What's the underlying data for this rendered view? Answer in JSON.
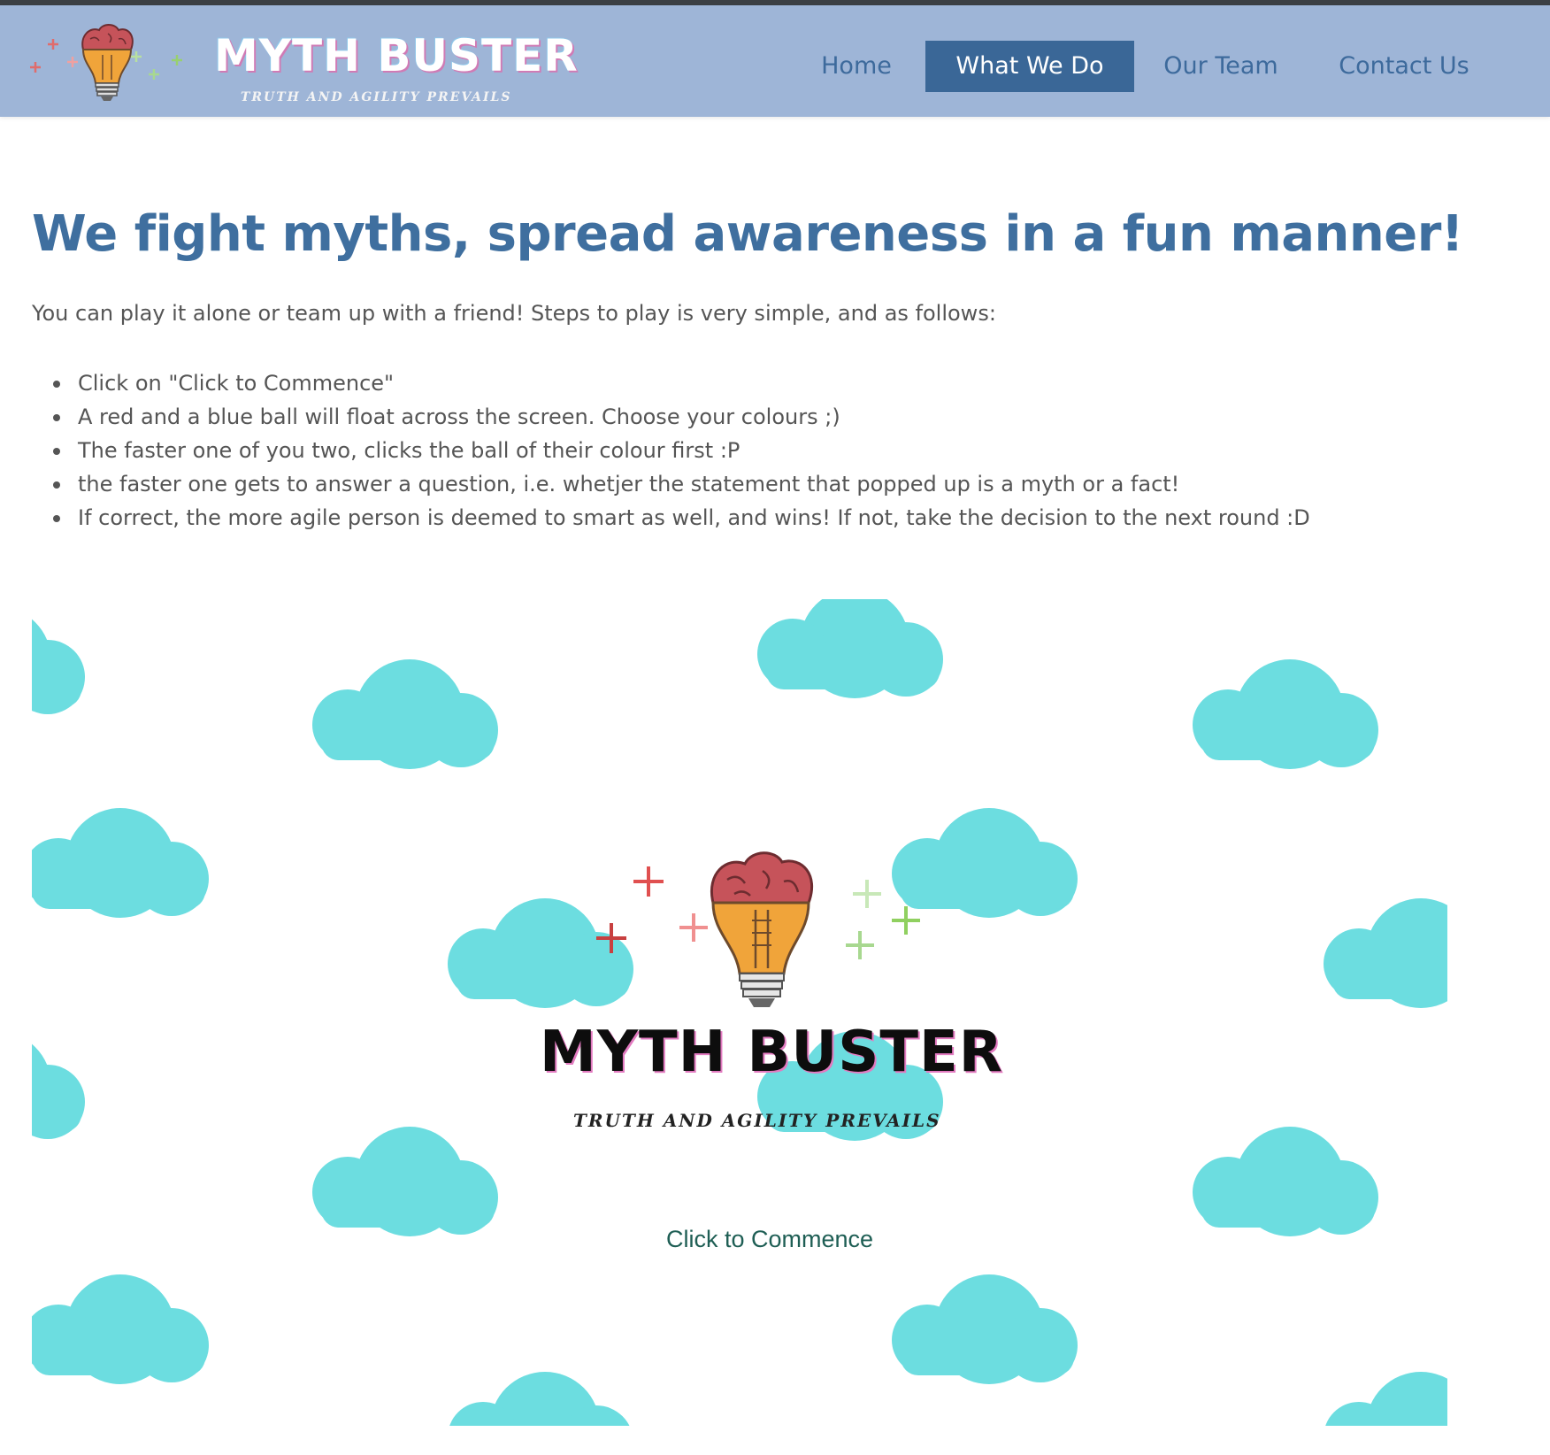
{
  "brand": {
    "title": "MYTH BUSTER",
    "tagline": "TRUTH AND AGILITY PREVAILS",
    "logo_icon": "brain-lightbulb-icon"
  },
  "nav": {
    "items": [
      {
        "label": "Home",
        "active": false
      },
      {
        "label": "What We Do",
        "active": true
      },
      {
        "label": "Our Team",
        "active": false
      },
      {
        "label": "Contact Us",
        "active": false
      }
    ]
  },
  "main": {
    "headline": "We fight myths, spread awareness in a fun manner!",
    "intro": "You can play it alone or team up with a friend! Steps to play is very simple, and as follows:",
    "steps": [
      "Click on \"Click to Commence\"",
      "A red and a blue ball will float across the screen. Choose your colours ;)",
      "The faster one of you two, clicks the ball of their colour first :P",
      "the faster one gets to answer a question, i.e. whetjer the statement that popped up is a myth or a fact!",
      "If correct, the more agile person is deemed to smart as well, and wins! If not, take the decision to the next round :D"
    ]
  },
  "game": {
    "title": "MYTH BUSTER",
    "tagline": "TRUTH AND AGILITY PREVAILS",
    "start_label": "Click to Commence",
    "background_icon": "cloud-icon"
  },
  "colors": {
    "navbar_bg": "#9eb5d7",
    "nav_active_bg": "#3a6797",
    "nav_text": "#3d6a9c",
    "headline": "#3f6f9f",
    "body_text": "#555555",
    "cloud": "#6cdde0",
    "commence_text": "#1e5e54"
  }
}
